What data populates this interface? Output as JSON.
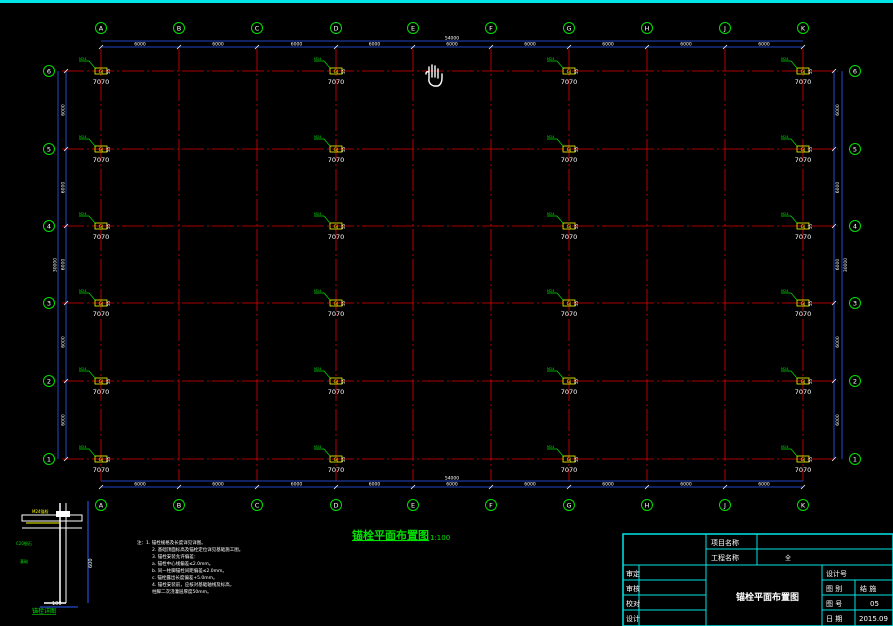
{
  "grid": {
    "cols": [
      "A",
      "B",
      "C",
      "D",
      "E",
      "F",
      "G",
      "H",
      "J",
      "K"
    ],
    "rows": [
      "6",
      "5",
      "4",
      "3",
      "2",
      "1"
    ],
    "spacings_x": [
      "6000",
      "6000",
      "6000",
      "6000",
      "6000",
      "6000",
      "6000",
      "6000",
      "6000"
    ],
    "spacings_y": [
      "6000",
      "6000",
      "6000",
      "6000",
      "6000"
    ],
    "total_x": "54000",
    "total_y": "30000"
  },
  "anchor_tag": "7070",
  "title": {
    "main": "锚栓平面布置图",
    "scale": "1:100"
  },
  "detail_caption": "锚栓详图",
  "detail_dims": [
    "100",
    "600"
  ],
  "notes": [
    "注：1. 锚栓规格及长度详见详图。",
    "2. 基础顶面标高及锚栓定位详见基础施工图。",
    "3. 锚栓安装允许偏差：",
    "a. 锚栓中心线偏差≤2.0mm。",
    "b. 同一柱脚锚栓间距偏差≤2.0mm。",
    "c. 锚栓露出长度偏差+5.0mm。",
    "4. 锚栓安装前，应核对基础轴线及标高，",
    "柱脚二次浇灌层厚度50mm。"
  ],
  "title_block": {
    "project_label": "项目名称",
    "engineering_label": "工程名称",
    "engineering_value": "全",
    "drawing_name": "锚栓平面布置图",
    "left_labels": [
      "审定",
      "审核",
      "校对",
      "设计"
    ],
    "design_no_label": "设计号",
    "drawing_cat_label": "图  别",
    "drawing_cat_value": "结  施",
    "drawing_no_label": "图  号",
    "drawing_no_value": "05",
    "date_label": "日  期",
    "date_value": "2015.09"
  },
  "colors": {
    "background": "#000000",
    "grid_line": "#e00000",
    "dimension": "#2a5cff",
    "bubble": "#00e000",
    "frame": "#00e5e5",
    "text": "#ffffff",
    "tag": "#ffff00"
  },
  "cursor_icon": "hand-pointer-icon"
}
